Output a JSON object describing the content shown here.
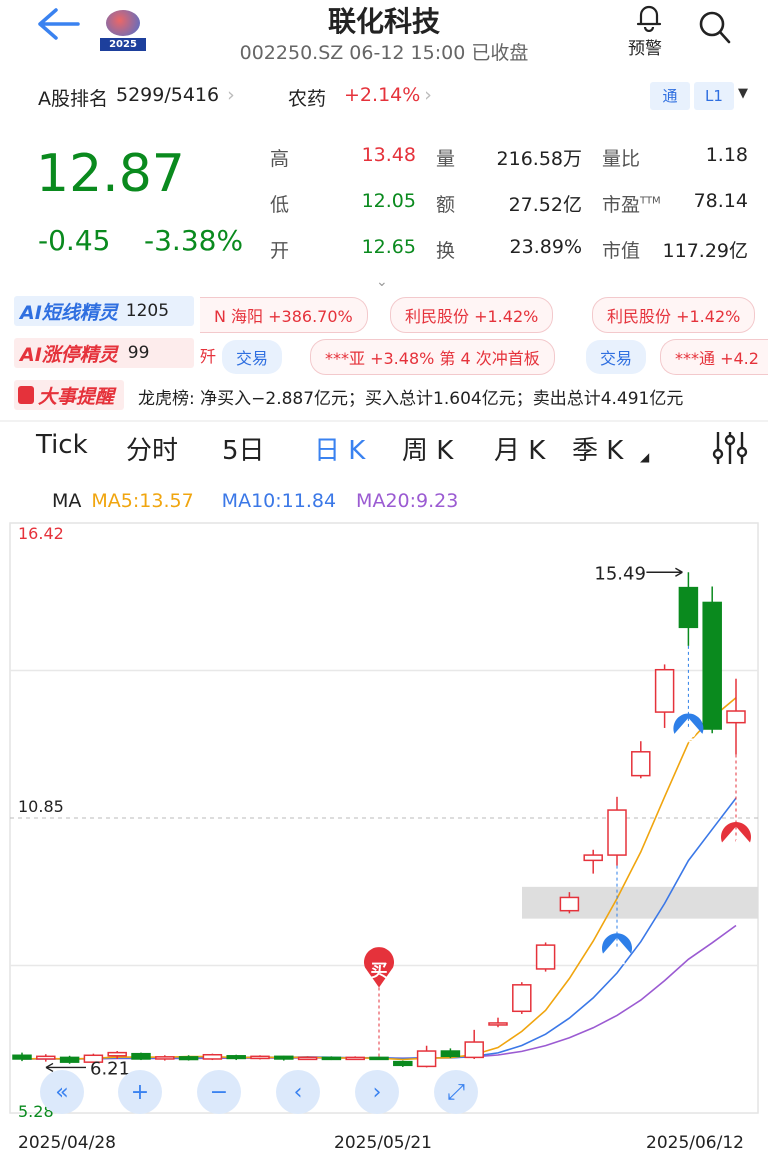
{
  "header": {
    "title": "联化科技",
    "subtitle": "002250.SZ 06-12 15:00 已收盘",
    "logo_year": "2025",
    "alert_label": "预警"
  },
  "rank": {
    "label": "A股排名",
    "value": "5299/5416",
    "sector": "农药",
    "sector_change": "+2.14%",
    "tong_label": "通",
    "level_label": "L1"
  },
  "quote": {
    "price": "12.87",
    "change": "-0.45",
    "change_pct": "-3.38%",
    "stats": [
      {
        "label": "高",
        "value": "13.48",
        "color": "#e5323b"
      },
      {
        "label": "量",
        "value": "216.58万",
        "color": "#222222"
      },
      {
        "label": "量比",
        "value": "1.18",
        "color": "#222222"
      },
      {
        "label": "低",
        "value": "12.05",
        "color": "#0a8a1e"
      },
      {
        "label": "额",
        "value": "27.52亿",
        "color": "#222222"
      },
      {
        "label": "市盈",
        "sup": "TTM",
        "value": "78.14",
        "color": "#222222"
      },
      {
        "label": "开",
        "value": "12.65",
        "color": "#0a8a1e"
      },
      {
        "label": "换",
        "value": "23.89%",
        "color": "#222222"
      },
      {
        "label": "市值",
        "value": "117.29亿",
        "color": "#222222"
      }
    ]
  },
  "ai": {
    "short_label": "AI短线精灵",
    "short_count": "1205",
    "short_items": [
      "N 海阳 +386.70%",
      "利民股份 +1.42%",
      "利民股份 +1.42%"
    ],
    "limit_label": "AI涨停精灵",
    "limit_count": "99",
    "limit_frag": "歼",
    "limit_items": [
      "***亚 +3.48% 第 4 次冲首板",
      "***通 +4.2"
    ],
    "trade_label": "交易"
  },
  "news": {
    "label": "大事提醒",
    "text": "龙虎榜: 净买入−2.887亿元；买入总计1.604亿元；卖出总计4.491亿元"
  },
  "tabs": [
    "Tick",
    "分时",
    "5日",
    "日 K",
    "周 K",
    "月 K",
    "季 K"
  ],
  "active_tab": "日 K",
  "ma": {
    "label": "MA",
    "ma5": "MA5:13.57",
    "ma10": "MA10:11.84",
    "ma20": "MA20:9.23",
    "ma5_color": "#f0a50f",
    "ma10_color": "#3b78e7",
    "ma20_color": "#9b5bd2"
  },
  "chart_data": {
    "type": "candlestick",
    "y_max_label": "16.42",
    "y_mid_label": "10.85",
    "y_min_label": "5.28",
    "ylim": [
      5.28,
      16.42
    ],
    "x_labels": [
      "2025/04/28",
      "2025/05/21",
      "2025/06/12"
    ],
    "high_annotation": "15.49",
    "low_annotation": "6.21",
    "candles": [
      {
        "o": 6.37,
        "c": 6.3,
        "h": 6.42,
        "l": 6.26
      },
      {
        "o": 6.3,
        "c": 6.35,
        "h": 6.39,
        "l": 6.25
      },
      {
        "o": 6.33,
        "c": 6.24,
        "h": 6.36,
        "l": 6.21
      },
      {
        "o": 6.24,
        "c": 6.37,
        "h": 6.4,
        "l": 6.22
      },
      {
        "o": 6.36,
        "c": 6.42,
        "h": 6.45,
        "l": 6.3
      },
      {
        "o": 6.4,
        "c": 6.3,
        "h": 6.42,
        "l": 6.28
      },
      {
        "o": 6.3,
        "c": 6.34,
        "h": 6.37,
        "l": 6.27
      },
      {
        "o": 6.34,
        "c": 6.29,
        "h": 6.37,
        "l": 6.27
      },
      {
        "o": 6.3,
        "c": 6.38,
        "h": 6.4,
        "l": 6.28
      },
      {
        "o": 6.36,
        "c": 6.31,
        "h": 6.38,
        "l": 6.28
      },
      {
        "o": 6.31,
        "c": 6.35,
        "h": 6.37,
        "l": 6.29
      },
      {
        "o": 6.35,
        "c": 6.3,
        "h": 6.36,
        "l": 6.27
      },
      {
        "o": 6.31,
        "c": 6.33,
        "h": 6.35,
        "l": 6.29
      },
      {
        "o": 6.33,
        "c": 6.3,
        "h": 6.35,
        "l": 6.28
      },
      {
        "o": 6.3,
        "c": 6.33,
        "h": 6.35,
        "l": 6.29
      },
      {
        "o": 6.33,
        "c": 6.31,
        "h": 6.34,
        "l": 6.29
      },
      {
        "o": 6.25,
        "c": 6.18,
        "h": 6.27,
        "l": 6.15
      },
      {
        "o": 6.16,
        "c": 6.45,
        "h": 6.55,
        "l": 6.14
      },
      {
        "o": 6.45,
        "c": 6.35,
        "h": 6.5,
        "l": 6.32
      },
      {
        "o": 6.33,
        "c": 6.62,
        "h": 6.85,
        "l": 6.3
      },
      {
        "o": 6.95,
        "c": 6.98,
        "h": 7.08,
        "l": 6.9
      },
      {
        "o": 7.2,
        "c": 7.7,
        "h": 7.75,
        "l": 7.15
      },
      {
        "o": 8.0,
        "c": 8.45,
        "h": 8.5,
        "l": 7.95
      },
      {
        "o": 9.1,
        "c": 9.35,
        "h": 9.45,
        "l": 9.05
      },
      {
        "o": 10.05,
        "c": 10.15,
        "h": 10.25,
        "l": 9.8
      },
      {
        "o": 10.15,
        "c": 11.0,
        "h": 11.25,
        "l": 9.95
      },
      {
        "o": 11.65,
        "c": 12.1,
        "h": 12.3,
        "l": 11.6
      },
      {
        "o": 12.85,
        "c": 13.65,
        "h": 13.75,
        "l": 12.55
      },
      {
        "o": 15.2,
        "c": 14.45,
        "h": 15.49,
        "l": 14.1
      },
      {
        "o": 14.92,
        "c": 12.53,
        "h": 15.22,
        "l": 12.45
      },
      {
        "o": 12.65,
        "c": 12.87,
        "h": 13.48,
        "l": 12.05
      }
    ],
    "markers": [
      {
        "index": 15,
        "type": "买"
      },
      {
        "index": 25,
        "type": "卖"
      },
      {
        "index": 28,
        "type": "卖"
      },
      {
        "index": 30,
        "type": "买"
      }
    ]
  },
  "controls": [
    "«",
    "+",
    "−",
    "‹",
    "›",
    "⤢"
  ]
}
